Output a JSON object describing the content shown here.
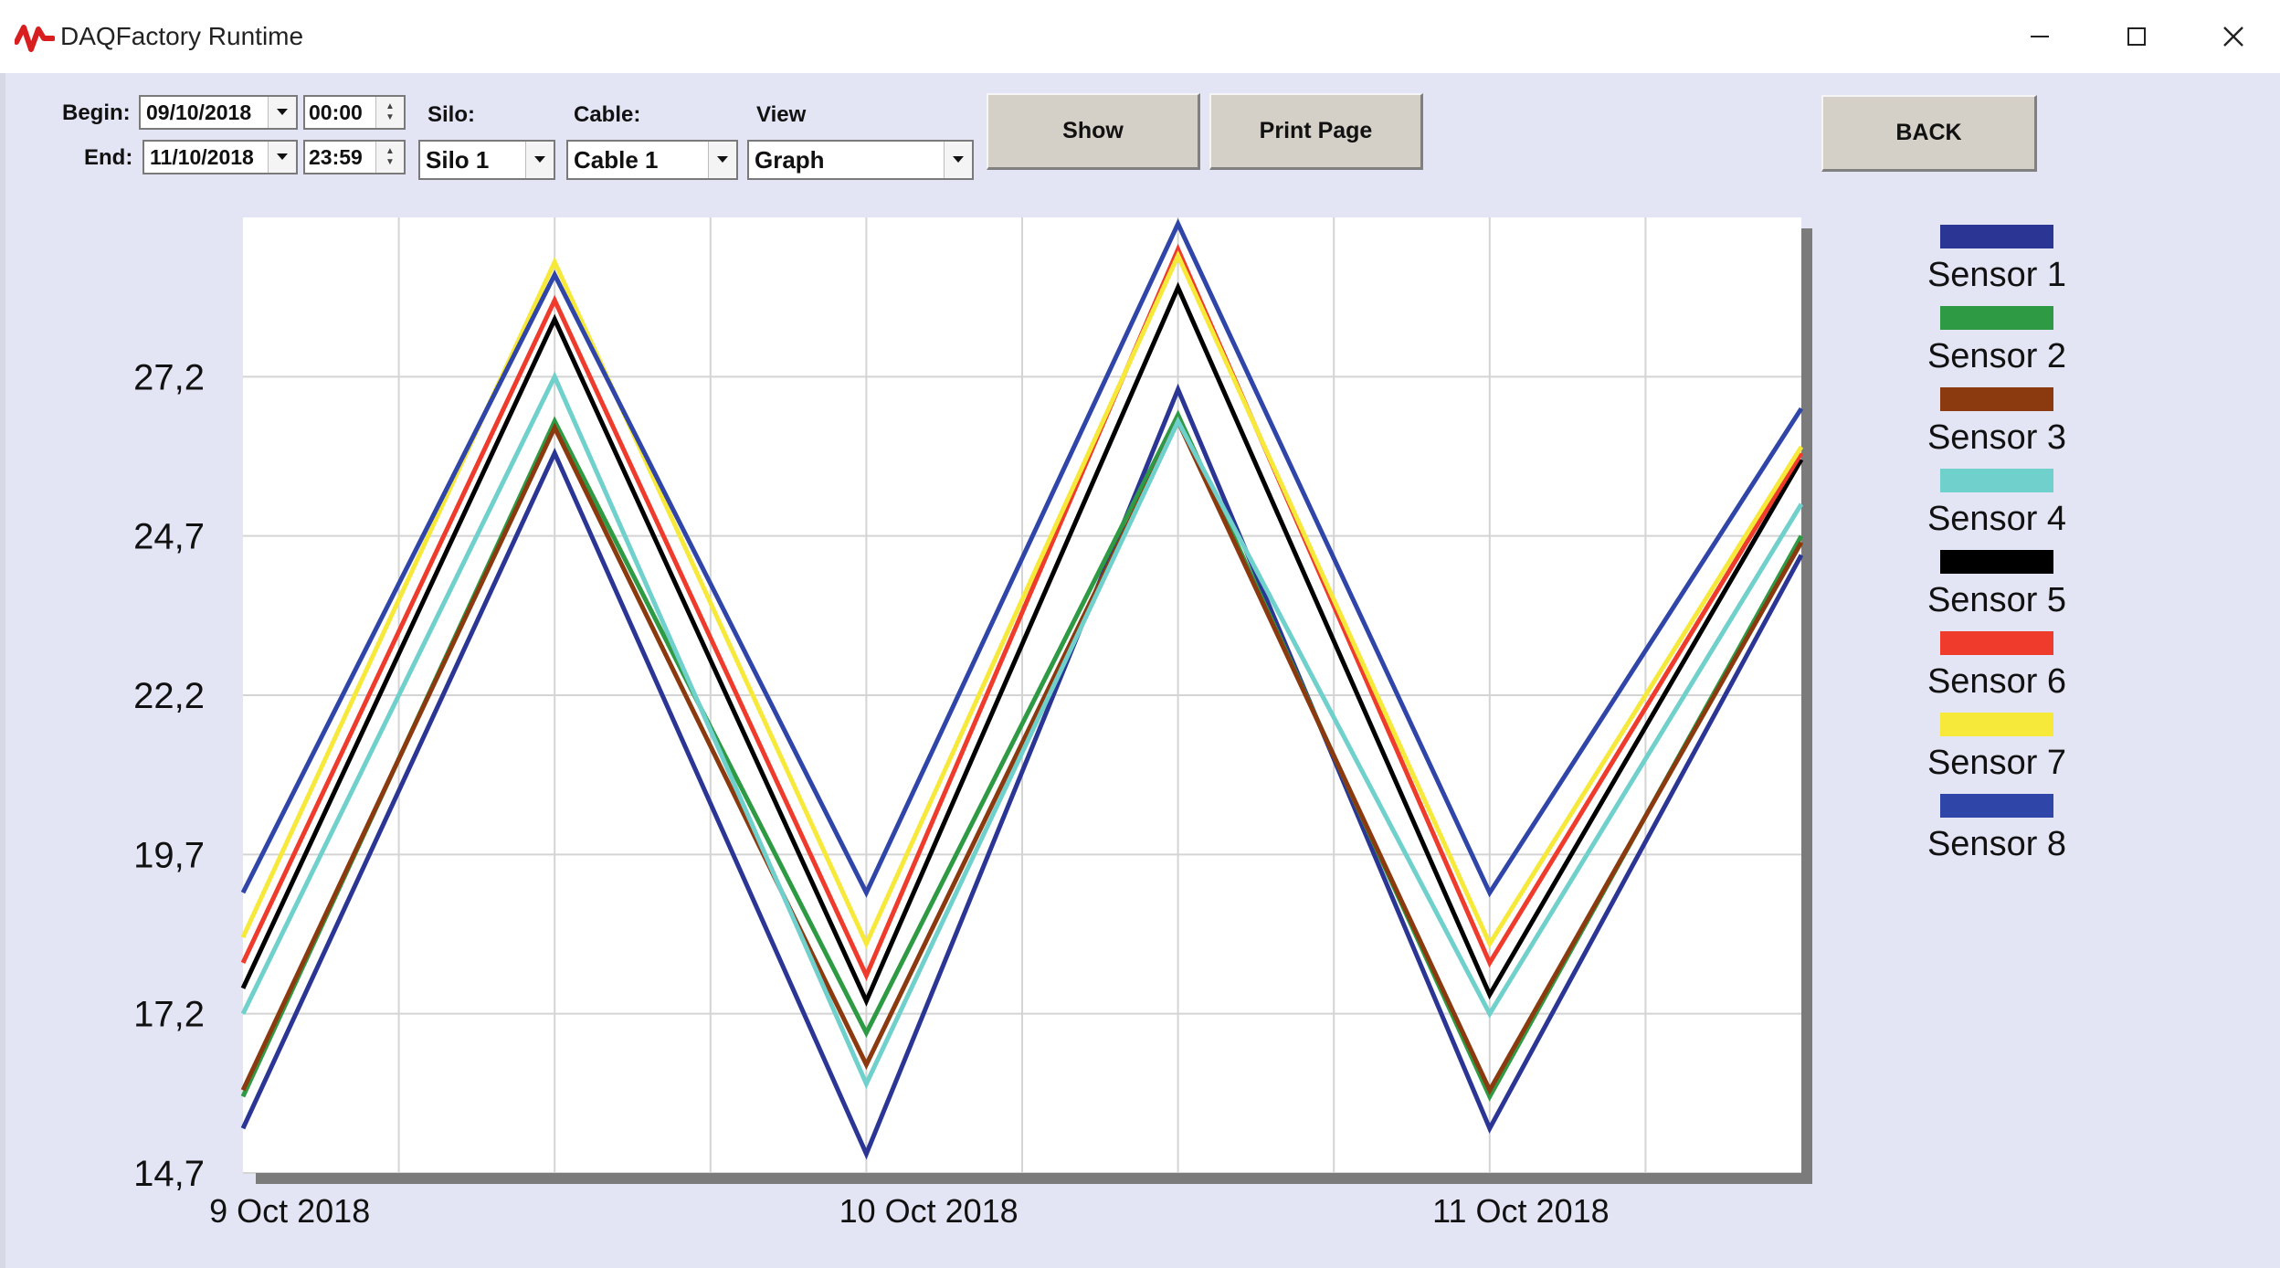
{
  "window": {
    "title": "DAQFactory Runtime"
  },
  "toolbar": {
    "begin_label": "Begin:",
    "end_label": "End:",
    "begin_date": "09/10/2018",
    "begin_time": "00:00",
    "end_date": "11/10/2018",
    "end_time": "23:59",
    "silo_label": "Silo:",
    "silo_value": "Silo 1",
    "cable_label": "Cable:",
    "cable_value": "Cable 1",
    "view_label": "View",
    "view_value": "Graph",
    "show_label": "Show",
    "print_label": "Print Page",
    "back_label": "BACK"
  },
  "colors": {
    "sensor1": "#2b3594",
    "sensor2": "#2e9a43",
    "sensor3": "#8b3a0f",
    "sensor4": "#6fd0cc",
    "sensor5": "#000000",
    "sensor6": "#ef3b2c",
    "sensor7": "#f7e93a",
    "sensor8": "#2f45a8"
  },
  "chart_data": {
    "type": "line",
    "ylim": [
      14.7,
      29.7
    ],
    "yticks": [
      "27,2",
      "24,7",
      "22,2",
      "19,7",
      "17,2",
      "14,7"
    ],
    "ytick_values": [
      27.2,
      24.7,
      22.2,
      19.7,
      17.2,
      14.7
    ],
    "xlim": [
      0,
      10
    ],
    "x": [
      0,
      2,
      4,
      6,
      8,
      10
    ],
    "xtick_labels": [
      "9 Oct 2018",
      "10 Oct 2018",
      "11 Oct 2018"
    ],
    "xtick_positions": [
      0.3,
      4.4,
      8.2
    ],
    "grid": true,
    "legend_position": "right",
    "series": [
      {
        "name": "Sensor 1",
        "values": [
          15.4,
          26.0,
          15.0,
          27.0,
          15.4,
          24.4
        ]
      },
      {
        "name": "Sensor 2",
        "values": [
          15.9,
          26.5,
          16.9,
          26.6,
          15.9,
          24.7
        ]
      },
      {
        "name": "Sensor 3",
        "values": [
          16.0,
          26.4,
          16.4,
          26.5,
          16.0,
          24.6
        ]
      },
      {
        "name": "Sensor 4",
        "values": [
          17.2,
          27.2,
          16.1,
          26.5,
          17.2,
          25.2
        ]
      },
      {
        "name": "Sensor 5",
        "values": [
          17.6,
          28.1,
          17.4,
          28.6,
          17.5,
          25.9
        ]
      },
      {
        "name": "Sensor 6",
        "values": [
          18.0,
          28.4,
          17.8,
          29.2,
          18.0,
          26.0
        ]
      },
      {
        "name": "Sensor 7",
        "values": [
          18.4,
          29.0,
          18.3,
          29.1,
          18.3,
          26.1
        ]
      },
      {
        "name": "Sensor 8",
        "values": [
          19.1,
          28.8,
          19.1,
          29.6,
          19.1,
          26.7
        ]
      }
    ]
  }
}
